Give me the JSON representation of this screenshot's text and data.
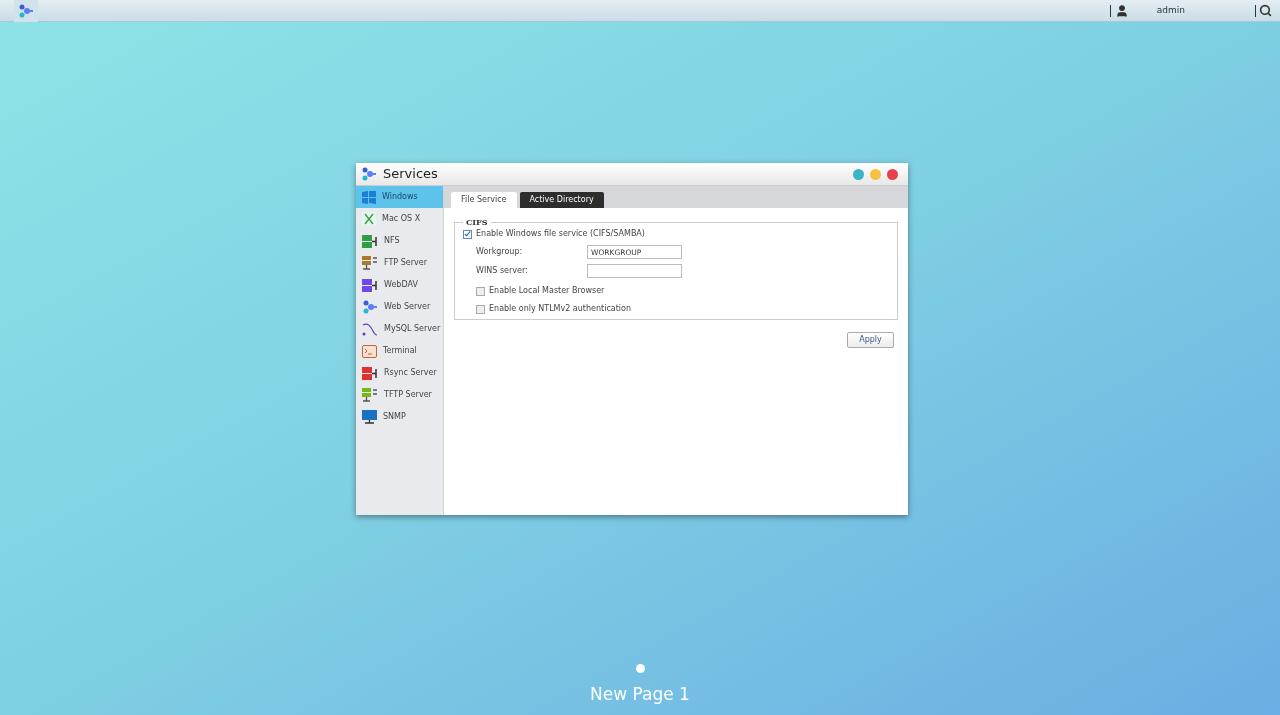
{
  "top_bar": {
    "user": "admin"
  },
  "window": {
    "title": "Services"
  },
  "sidebar": {
    "items": [
      {
        "label": "Windows",
        "selected": true
      },
      {
        "label": "Mac OS X",
        "selected": false
      },
      {
        "label": "NFS",
        "selected": false
      },
      {
        "label": "FTP Server",
        "selected": false
      },
      {
        "label": "WebDAV",
        "selected": false
      },
      {
        "label": "Web Server",
        "selected": false
      },
      {
        "label": "MySQL Server",
        "selected": false
      },
      {
        "label": "Terminal",
        "selected": false
      },
      {
        "label": "Rsync Server",
        "selected": false
      },
      {
        "label": "TFTP Server",
        "selected": false
      },
      {
        "label": "SNMP",
        "selected": false
      }
    ]
  },
  "tabs": [
    {
      "label": "File Service",
      "selected": true
    },
    {
      "label": "Active Directory",
      "selected": false
    }
  ],
  "cifs": {
    "legend": "CIFS",
    "enable": {
      "label": "Enable Windows file service (CIFS/SAMBA)",
      "checked": true
    },
    "fields": [
      {
        "label": "Workgroup:",
        "value": "WORKGROUP"
      },
      {
        "label": "WINS server:"
      }
    ],
    "options": [
      {
        "label": "Enable Local Master Browser",
        "checked": false
      },
      {
        "label": "Enable only NTLMv2 authentication",
        "checked": false
      }
    ]
  },
  "apply_button": "Apply",
  "desktop": {
    "pages": [
      {
        "selected": true
      }
    ],
    "page_label": "New Page 1"
  }
}
